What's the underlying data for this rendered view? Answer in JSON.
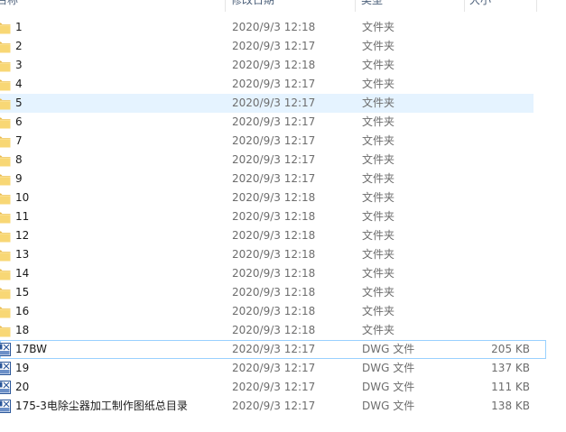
{
  "columns": {
    "name": "名称",
    "date": "修改日期",
    "type": "类型",
    "size": "大小"
  },
  "icons": {
    "folder": "folder-icon",
    "dwg": "dwg-file-icon"
  },
  "colors": {
    "hover_bg": "#e5f3ff",
    "selected_border": "#99d1ff",
    "folder_yellow": "#f8d775",
    "dwg_blue": "#2b579a"
  },
  "rows": [
    {
      "name": "1",
      "date": "2020/9/3 12:18",
      "type": "文件夹",
      "size": "",
      "kind": "folder"
    },
    {
      "name": "2",
      "date": "2020/9/3 12:17",
      "type": "文件夹",
      "size": "",
      "kind": "folder"
    },
    {
      "name": "3",
      "date": "2020/9/3 12:18",
      "type": "文件夹",
      "size": "",
      "kind": "folder"
    },
    {
      "name": "4",
      "date": "2020/9/3 12:17",
      "type": "文件夹",
      "size": "",
      "kind": "folder"
    },
    {
      "name": "5",
      "date": "2020/9/3 12:17",
      "type": "文件夹",
      "size": "",
      "kind": "folder",
      "state": "hover"
    },
    {
      "name": "6",
      "date": "2020/9/3 12:17",
      "type": "文件夹",
      "size": "",
      "kind": "folder"
    },
    {
      "name": "7",
      "date": "2020/9/3 12:17",
      "type": "文件夹",
      "size": "",
      "kind": "folder"
    },
    {
      "name": "8",
      "date": "2020/9/3 12:17",
      "type": "文件夹",
      "size": "",
      "kind": "folder"
    },
    {
      "name": "9",
      "date": "2020/9/3 12:17",
      "type": "文件夹",
      "size": "",
      "kind": "folder"
    },
    {
      "name": "10",
      "date": "2020/9/3 12:18",
      "type": "文件夹",
      "size": "",
      "kind": "folder"
    },
    {
      "name": "11",
      "date": "2020/9/3 12:18",
      "type": "文件夹",
      "size": "",
      "kind": "folder"
    },
    {
      "name": "12",
      "date": "2020/9/3 12:18",
      "type": "文件夹",
      "size": "",
      "kind": "folder"
    },
    {
      "name": "13",
      "date": "2020/9/3 12:18",
      "type": "文件夹",
      "size": "",
      "kind": "folder"
    },
    {
      "name": "14",
      "date": "2020/9/3 12:18",
      "type": "文件夹",
      "size": "",
      "kind": "folder"
    },
    {
      "name": "15",
      "date": "2020/9/3 12:18",
      "type": "文件夹",
      "size": "",
      "kind": "folder"
    },
    {
      "name": "16",
      "date": "2020/9/3 12:18",
      "type": "文件夹",
      "size": "",
      "kind": "folder"
    },
    {
      "name": "18",
      "date": "2020/9/3 12:18",
      "type": "文件夹",
      "size": "",
      "kind": "folder"
    },
    {
      "name": "17BW",
      "date": "2020/9/3 12:17",
      "type": "DWG 文件",
      "size": "205 KB",
      "kind": "dwg",
      "state": "selected"
    },
    {
      "name": "19",
      "date": "2020/9/3 12:17",
      "type": "DWG 文件",
      "size": "137 KB",
      "kind": "dwg"
    },
    {
      "name": "20",
      "date": "2020/9/3 12:17",
      "type": "DWG 文件",
      "size": "111 KB",
      "kind": "dwg"
    },
    {
      "name": "175-3电除尘器加工制作图纸总目录",
      "date": "2020/9/3 12:17",
      "type": "DWG 文件",
      "size": "138 KB",
      "kind": "dwg"
    }
  ]
}
